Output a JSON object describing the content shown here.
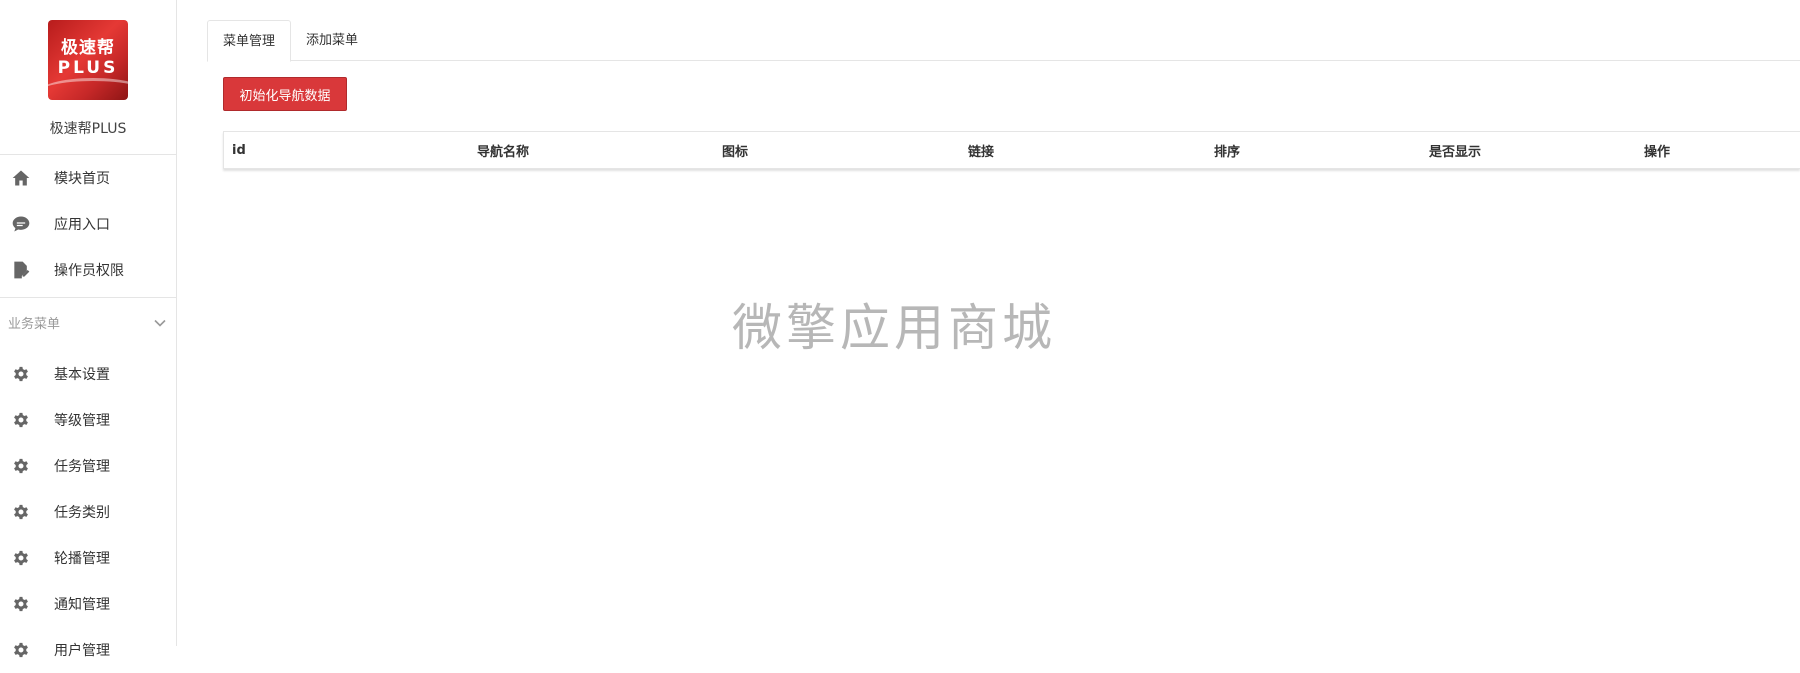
{
  "sidebar": {
    "logo": {
      "line1": "极速帮",
      "line2": "PLUS"
    },
    "app_name": "极速帮PLUS",
    "top_items": [
      {
        "label": "模块首页",
        "icon": "home-icon"
      },
      {
        "label": "应用入口",
        "icon": "chat-icon"
      },
      {
        "label": "操作员权限",
        "icon": "document-edit-icon"
      }
    ],
    "group": {
      "title": "业务菜单",
      "items": [
        {
          "label": "基本设置",
          "icon": "gear-icon"
        },
        {
          "label": "等级管理",
          "icon": "gear-icon"
        },
        {
          "label": "任务管理",
          "icon": "gear-icon"
        },
        {
          "label": "任务类别",
          "icon": "gear-icon"
        },
        {
          "label": "轮播管理",
          "icon": "gear-icon"
        },
        {
          "label": "通知管理",
          "icon": "gear-icon"
        },
        {
          "label": "用户管理",
          "icon": "gear-icon"
        }
      ]
    }
  },
  "tabs": [
    {
      "label": "菜单管理",
      "active": true
    },
    {
      "label": "添加菜单",
      "active": false
    }
  ],
  "init_button": {
    "label": "初始化导航数据"
  },
  "table": {
    "columns": [
      "id",
      "导航名称",
      "图标",
      "链接",
      "排序",
      "是否显示",
      "操作"
    ]
  },
  "watermark": "微擎应用商城",
  "colors": {
    "primary_button": "#d9383a"
  }
}
